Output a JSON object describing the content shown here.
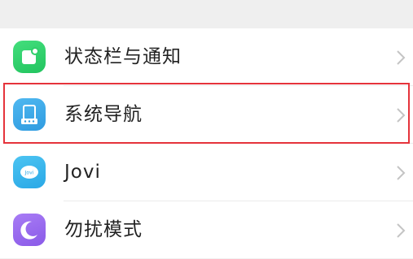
{
  "settings_list": {
    "items": [
      {
        "label": "状态栏与通知",
        "icon": "status-bar-notification-icon",
        "icon_color": "#2fcf6a"
      },
      {
        "label": "系统导航",
        "icon": "system-navigation-icon",
        "icon_color": "#3aa7e8"
      },
      {
        "label": "Jovi",
        "icon": "jovi-icon",
        "icon_color": "#35b4ea"
      },
      {
        "label": "勿扰模式",
        "icon": "do-not-disturb-icon",
        "icon_color": "#9a6cf0"
      }
    ]
  },
  "highlight_color": "#e5333b",
  "chevron_color": "#c4c4c4"
}
